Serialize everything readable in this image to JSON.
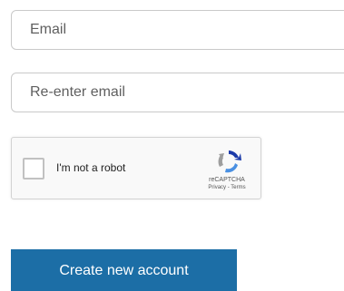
{
  "form": {
    "email": {
      "value": "",
      "placeholder": "Email"
    },
    "reenter_email": {
      "value": "",
      "placeholder": "Re-enter email"
    },
    "recaptcha": {
      "label": "I'm not a robot",
      "checked": false,
      "brand": "reCAPTCHA",
      "privacy_link": "Privacy",
      "separator": " - ",
      "terms_link": "Terms"
    },
    "submit_label": "Create new account"
  },
  "colors": {
    "button_background": "#1c6ea6",
    "button_text": "#ffffff",
    "field_border": "#c9c9c9",
    "recaptcha_background": "#f9f9f9"
  },
  "icons": {
    "recaptcha_logo": "recaptcha-logo-icon"
  }
}
